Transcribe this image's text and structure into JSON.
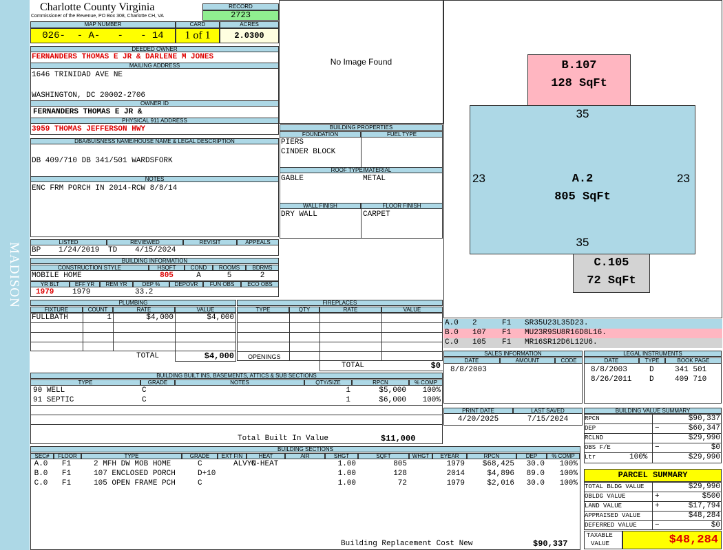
{
  "header": {
    "county": "Charlotte County Virginia",
    "commissioner": "Commissioner of the Revenue, PO Box 308, Charlotte CH, VA",
    "record_label": "RECORD",
    "record": "2723",
    "map_label": "MAP NUMBER",
    "map_number": "026-  - A-   -   - 14",
    "card_label": "CARD",
    "card": "1 of 1",
    "acres_label": "ACRES",
    "acres": "2.0300"
  },
  "side_label": "MADISON",
  "owner": {
    "deeded_label": "DEEDED OWNER",
    "deeded": "FERNANDERS THOMAS E JR & DARLENE M JONES",
    "mailing_label": "MAILING ADDRESS",
    "addr1": "1646 TRINIDAD AVE NE",
    "addr2": "WASHINGTON, DC 20002-2706",
    "owner_id_label": "OWNER ID",
    "owner_id": "FERNANDERS THOMAS E JR &",
    "physical_label": "PHYSICAL 911 ADDRESS",
    "physical": "3959 THOMAS JEFFERSON HWY",
    "dba_label": "DBA/BUISNESS NAME/HOUSE NAME & LEGAL DESCRIPTION",
    "dba": "DB 409/710 DB 341/501 WARDSFORK",
    "notes_label": "NOTES",
    "notes": "ENC FRM PORCH IN 2014-RCW 8/8/14"
  },
  "image": {
    "text": "No Image Found"
  },
  "building_props": {
    "title": "BUILDING PROPERTIES",
    "foundation_label": "FOUNDATION",
    "fuel_label": "FUEL TYPE",
    "foundation1": "PIERS",
    "foundation2": "CINDER BLOCK",
    "roof_label": "ROOF TYPE/MATERIAL",
    "roof_type": "GABLE",
    "roof_mat": "METAL",
    "wall_label": "WALL FINISH",
    "floor_label": "FLOOR FINISH",
    "wall": "DRY WALL",
    "floor": "CARPET"
  },
  "sketch": {
    "b_label": "B.107",
    "b_area": "128 SqFt",
    "a_label": "A.2",
    "a_area": "805 SqFt",
    "c_label": "C.105",
    "c_area": "72 SqFt",
    "dim_top": "35",
    "dim_bottom": "35",
    "dim_left": "23",
    "dim_right": "23"
  },
  "sketch_codes": [
    {
      "id": "A.0",
      "n": "2",
      "f": "F1",
      "code": "SR35U23L35D23."
    },
    {
      "id": "B.0",
      "n": "107",
      "f": "F1",
      "code": "MU23R9SU8R16D8L16."
    },
    {
      "id": "C.0",
      "n": "105",
      "f": "F1",
      "code": "MR16SR12D6L12U6."
    }
  ],
  "listed": {
    "listed_label": "LISTED",
    "reviewed_label": "REVIEWED",
    "revisit_label": "REVISIT",
    "appeals_label": "APPEALS",
    "listed_by": "BP",
    "listed_date": "1/24/2019",
    "reviewed_by": "TD",
    "reviewed_date": "4/15/2024"
  },
  "building_info": {
    "title": "BUILDING INFORMATION",
    "style_label": "CONSTRUCTION STYLE",
    "hsqft_label": "HSQFT",
    "cond_label": "COND",
    "rooms_label": "ROOMS",
    "bdrms_label": "BDRMS",
    "style": "MOBILE HOME",
    "hsqft": "805",
    "cond": "A",
    "rooms": "5",
    "bdrms": "2",
    "yrblt_label": "YR BLT",
    "effyr_label": "EFF YR",
    "remyr_label": "REM YR",
    "dep_label": "DEP %",
    "depovr_label": "DEPOVR",
    "funobs_label": "FUN OBS",
    "ecoobs_label": "ECO OBS",
    "yrblt": "1979",
    "effyr": "1979",
    "dep": "33.2"
  },
  "plumbing": {
    "title": "PLUMBING",
    "fixture_label": "FIXTURE",
    "count_label": "COUNT",
    "rate_label": "RATE",
    "value_label": "VALUE",
    "fixture": "FULLBATH",
    "count": "1",
    "rate": "$4,000",
    "value": "$4,000",
    "total_label": "TOTAL",
    "total": "$4,000"
  },
  "fireplaces": {
    "title": "FIREPLACES",
    "type_label": "TYPE",
    "qty_label": "QTY",
    "rate_label": "RATE",
    "value_label": "VALUE",
    "openings_label": "OPENINGS",
    "total_label": "TOTAL",
    "total": "$0"
  },
  "sales": {
    "title": "SALES INFORMATION",
    "date_label": "DATE",
    "amount_label": "AMOUNT",
    "code_label": "CODE",
    "date": "8/8/2003"
  },
  "legal": {
    "title": "LEGAL INSTRUMENTS",
    "date_label": "DATE",
    "type_label": "TYPE",
    "book_label": "BOOK PAGE",
    "rows": [
      {
        "date": "8/8/2003",
        "type": "D",
        "book": "341 501"
      },
      {
        "date": "8/26/2011",
        "type": "D",
        "book": "409 710"
      }
    ]
  },
  "builtins": {
    "title": "BUILDING BUILT INS, BASEMENTS, ATTICS & SUB SECTIONS",
    "type_label": "TYPE",
    "grade_label": "GRADE",
    "notes_label": "NOTES",
    "qty_label": "QTY/SIZE",
    "rpcn_label": "RPCN",
    "comp_label": "% COMP",
    "rows": [
      {
        "type": "90 WELL",
        "grade": "C",
        "qty": "1",
        "rpcn": "$5,000",
        "comp": "100%"
      },
      {
        "type": "91 SEPTIC",
        "grade": "C",
        "qty": "1",
        "rpcn": "$6,000",
        "comp": "100%"
      }
    ],
    "total_label": "Total Built In Value",
    "total": "$11,000"
  },
  "dates": {
    "print_label": "PRINT DATE",
    "saved_label": "LAST SAVED",
    "print": "4/20/2025",
    "saved": "7/15/2024"
  },
  "value_summary": {
    "title": "BUILDING VALUE SUMMARY",
    "rpcn_label": "RPCN",
    "rpcn": "$90,337",
    "dep_label": "DEP",
    "dep": "$60,347",
    "rclnd_label": "RCLND",
    "rclnd": "$29,990",
    "obs_label": "OBS F/E",
    "obs": "$0",
    "ltr_label": "Ltr",
    "ltr_pct": "100%",
    "ltr": "$29,990"
  },
  "sections": {
    "title": "BUILDING SECTIONS",
    "headers": [
      "SEC#",
      "FLOOR",
      "TYPE",
      "GRADE",
      "EXT FIN",
      "HEAT",
      "AIR",
      "SHGT",
      "SQFT",
      "WHGT",
      "EYEAR",
      "RPCN",
      "DEP",
      "% COMP"
    ],
    "rows": [
      {
        "sec": "A.0",
        "floor": "F1",
        "type": "2 MFH DW MOB HOME",
        "grade": "C",
        "ext": "ALVYN",
        "heat": "C-HEAT",
        "air": "",
        "shgt": "1.00",
        "sqft": "805",
        "whgt": "",
        "eyear": "1979",
        "rpcn": "$68,425",
        "dep": "30.0",
        "comp": "100%"
      },
      {
        "sec": "B.0",
        "floor": "F1",
        "type": "107 ENCLOSED PORCH",
        "grade": "D+10",
        "ext": "",
        "heat": "",
        "air": "",
        "shgt": "1.00",
        "sqft": "128",
        "whgt": "",
        "eyear": "2014",
        "rpcn": "$4,896",
        "dep": "89.0",
        "comp": "100%"
      },
      {
        "sec": "C.0",
        "floor": "F1",
        "type": "105 OPEN FRAME PCH",
        "grade": "C",
        "ext": "",
        "heat": "",
        "air": "",
        "shgt": "1.00",
        "sqft": "72",
        "whgt": "",
        "eyear": "1979",
        "rpcn": "$2,016",
        "dep": "30.0",
        "comp": "100%"
      }
    ],
    "brcn_label": "Building Replacement Cost New",
    "brcn": "$90,337"
  },
  "parcel": {
    "title": "PARCEL SUMMARY",
    "bldg_label": "TOTAL BLDG VALUE",
    "bldg": "$29,990",
    "obldg_label": "OBLDG VALUE",
    "obldg": "$500",
    "land_label": "LAND VALUE",
    "land": "$17,794",
    "appraised_label": "APPRAISED VALUE",
    "appraised": "$48,284",
    "deferred_label": "DEFERRED VALUE",
    "deferred": "$0",
    "taxable_label1": "TAXABLE",
    "taxable_label2": "VALUE",
    "taxable": "$48,284"
  },
  "colors": {
    "sidebar": "#add8e6",
    "header": "#add8e6",
    "yellow": "#ffff00",
    "green": "#90ee90",
    "pink": "#ffb6c1",
    "grey": "#d3d3d3",
    "red": "#dd0000"
  }
}
